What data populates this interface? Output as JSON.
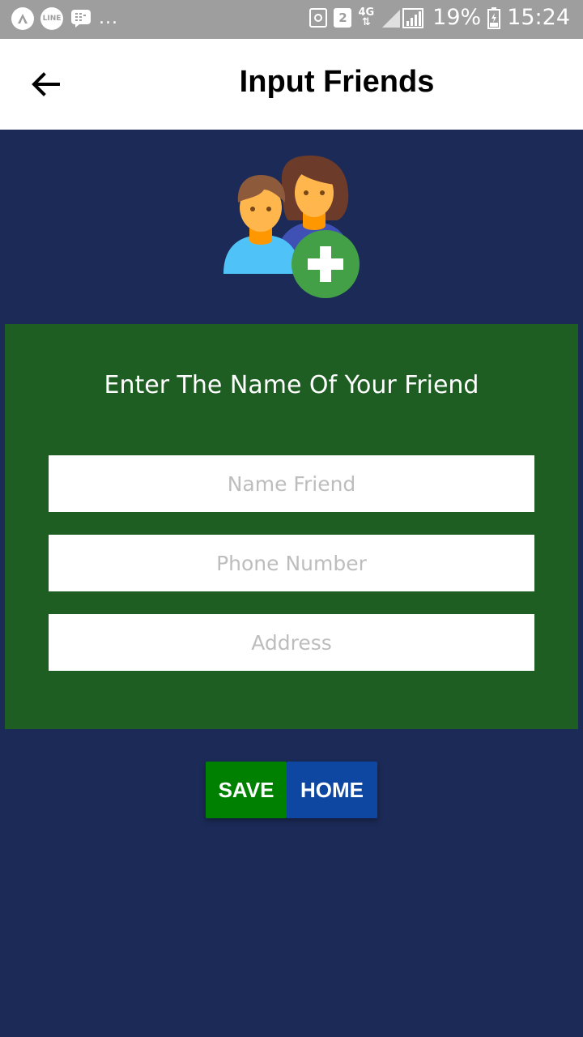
{
  "status_bar": {
    "left_icons": [
      "notification-a-icon",
      "line-icon",
      "bbm-icon"
    ],
    "line_label": "LINE",
    "overflow": "...",
    "sim_badge": "2",
    "network": "4G",
    "battery_percent": "19%",
    "time": "15:24"
  },
  "app_bar": {
    "back_icon": "arrow-left-icon",
    "title": "Input Friends"
  },
  "hero": {
    "icon": "add-friends-icon"
  },
  "form": {
    "heading": "Enter The Name Of Your Friend",
    "name_placeholder": "Name Friend",
    "phone_placeholder": "Phone Number",
    "address_placeholder": "Address"
  },
  "actions": {
    "save_label": "SAVE",
    "home_label": "HOME"
  },
  "colors": {
    "status_bar": "#9e9e9e",
    "background": "#1b2a57",
    "panel": "#1f5e23",
    "save": "#008000",
    "home": "#0d47a1",
    "plus_badge": "#43a047"
  }
}
